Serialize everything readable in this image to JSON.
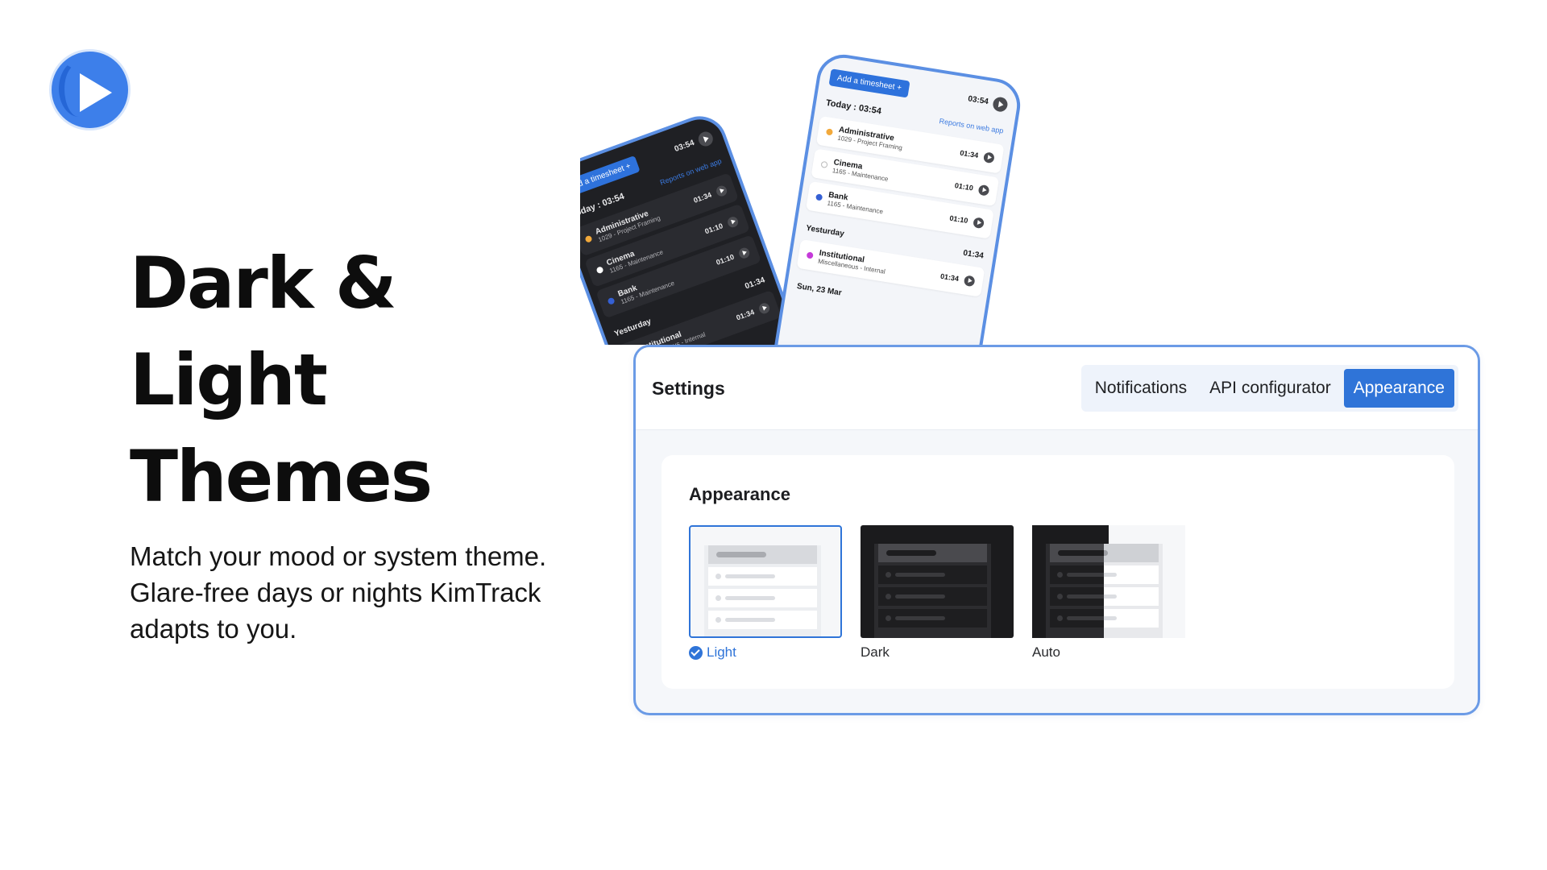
{
  "hero": {
    "title_lines": [
      "Dark &",
      "Light",
      "Themes"
    ],
    "subtitle": "Match your mood or system theme. Glare-free days or nights KimTrack adapts to you."
  },
  "phone": {
    "add_label": "Add a timesheet +",
    "total": "03:54",
    "today_label": "Today :",
    "today_total": "03:54",
    "reports_link": "Reports on web app",
    "entries": [
      {
        "name": "Administrative",
        "project": "1029 - Project Framing",
        "time": "01:34",
        "color": "#f2a93b"
      },
      {
        "name": "Cinema",
        "project": "1165 - Maintenance",
        "time": "01:10",
        "color": "#ffffff"
      },
      {
        "name": "Bank",
        "project": "1165 - Maintenance",
        "time": "01:10",
        "color": "#3560d4"
      }
    ],
    "yesterday_label": "Yesturday",
    "yesterday_total": "01:34",
    "yesterday_entries": [
      {
        "name": "Institutional",
        "project": "Miscellaneous - Internal",
        "time": "01:34",
        "color": "#c53ad9"
      }
    ],
    "next_day_label": "Sun, 23 Mar"
  },
  "settings": {
    "title": "Settings",
    "tabs": [
      "Notifications",
      "API configurator",
      "Appearance"
    ],
    "active_tab": "Appearance",
    "panel_title": "Appearance",
    "options": [
      {
        "label": "Light",
        "selected": true
      },
      {
        "label": "Dark",
        "selected": false
      },
      {
        "label": "Auto",
        "selected": false
      }
    ]
  },
  "colors": {
    "accent": "#2f74d8",
    "logo": "#3d7fea",
    "border": "#6b9be6"
  }
}
